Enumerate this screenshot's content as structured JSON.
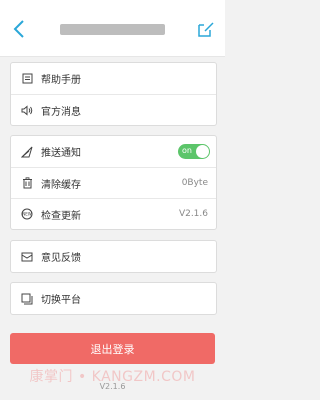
{
  "header": {
    "back_icon": "chevron-left-icon",
    "edit_icon": "edit-icon"
  },
  "help_group": [
    {
      "label": "帮助手册",
      "icon": "book-icon"
    },
    {
      "label": "官方消息",
      "icon": "speaker-icon"
    }
  ],
  "settings_group": {
    "push": {
      "label": "推送通知",
      "icon": "send-icon",
      "toggle_text": "on",
      "enabled": true
    },
    "cache": {
      "label": "清除缓存",
      "icon": "trash-icon",
      "value": "0Byte"
    },
    "update": {
      "label": "检查更新",
      "icon": "new-badge-icon",
      "value": "V2.1.6"
    }
  },
  "feedback": {
    "label": "意见反馈",
    "icon": "mail-icon"
  },
  "switch_platform": {
    "label": "切换平台",
    "icon": "copy-icon"
  },
  "logout_label": "退出登录",
  "version": "V2.1.6",
  "watermark": "康掌门 • KANGZM.COM",
  "colors": {
    "accent": "#2aa7d8",
    "toggle_on": "#5cc56a",
    "logout": "#f06a66",
    "background": "#f2f2f2"
  }
}
